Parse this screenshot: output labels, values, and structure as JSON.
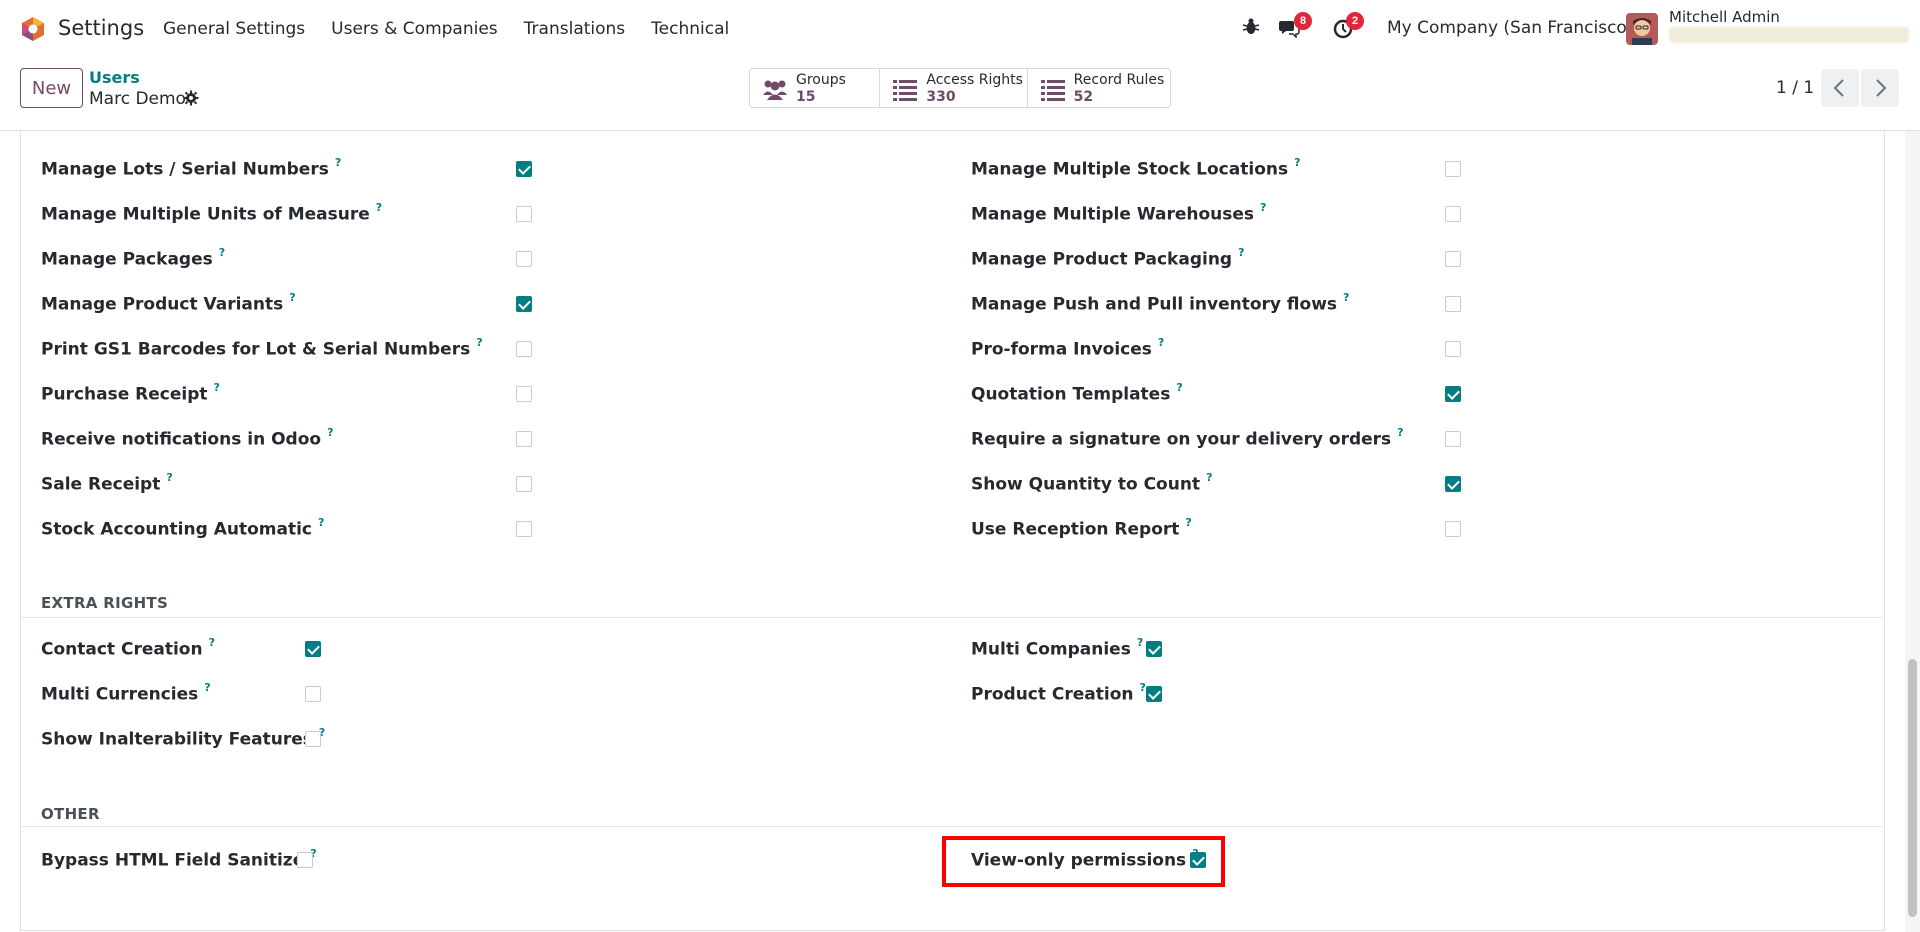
{
  "navbar": {
    "app_name": "Settings",
    "menu": [
      "General Settings",
      "Users & Companies",
      "Translations",
      "Technical"
    ],
    "messages_count": "8",
    "activities_count": "2",
    "company": "My Company (San Francisco)",
    "user_name": "Mitchell Admin"
  },
  "control_panel": {
    "new_label": "New",
    "breadcrumb_parent": "Users",
    "breadcrumb_current": "Marc Demo",
    "smart_buttons": [
      {
        "label": "Groups",
        "value": "15"
      },
      {
        "label": "Access Rights",
        "value": "330"
      },
      {
        "label": "Record Rules",
        "value": "52"
      }
    ],
    "pager": "1 / 1"
  },
  "rights": [
    {
      "label": "Manage Lots / Serial Numbers",
      "checked": true,
      "col": 0
    },
    {
      "label": "Manage Multiple Stock Locations",
      "checked": false,
      "col": 1
    },
    {
      "label": "Manage Multiple Units of Measure",
      "checked": false,
      "col": 0
    },
    {
      "label": "Manage Multiple Warehouses",
      "checked": false,
      "col": 1
    },
    {
      "label": "Manage Packages",
      "checked": false,
      "col": 0
    },
    {
      "label": "Manage Product Packaging",
      "checked": false,
      "col": 1
    },
    {
      "label": "Manage Product Variants",
      "checked": true,
      "col": 0
    },
    {
      "label": "Manage Push and Pull inventory flows",
      "checked": false,
      "col": 1
    },
    {
      "label": "Print GS1 Barcodes for Lot & Serial Numbers",
      "checked": false,
      "col": 0
    },
    {
      "label": "Pro-forma Invoices",
      "checked": false,
      "col": 1
    },
    {
      "label": "Purchase Receipt",
      "checked": false,
      "col": 0
    },
    {
      "label": "Quotation Templates",
      "checked": true,
      "col": 1
    },
    {
      "label": "Receive notifications in Odoo",
      "checked": false,
      "col": 0
    },
    {
      "label": "Require a signature on your delivery orders",
      "checked": false,
      "col": 1
    },
    {
      "label": "Sale Receipt",
      "checked": false,
      "col": 0
    },
    {
      "label": "Show Quantity to Count",
      "checked": true,
      "col": 1
    },
    {
      "label": "Stock Accounting Automatic",
      "checked": false,
      "col": 0
    },
    {
      "label": "Use Reception Report",
      "checked": false,
      "col": 1
    }
  ],
  "extra_rights": {
    "title": "EXTRA RIGHTS",
    "items": [
      {
        "label": "Contact Creation",
        "checked": true
      },
      {
        "label": "Multi Companies",
        "checked": true
      },
      {
        "label": "Multi Currencies",
        "checked": false
      },
      {
        "label": "Product Creation",
        "checked": true
      },
      {
        "label": "Show Inalterability Features",
        "checked": false
      }
    ]
  },
  "other": {
    "title": "OTHER",
    "items": [
      {
        "label": "Bypass HTML Field Sanitize",
        "checked": false
      },
      {
        "label": "View-only permissions",
        "checked": true
      }
    ]
  },
  "help_mark": "?",
  "colors": {
    "brand": "#714b67",
    "accent": "#017e84",
    "highlight": "#ff0000",
    "badge": "#e0263a"
  }
}
